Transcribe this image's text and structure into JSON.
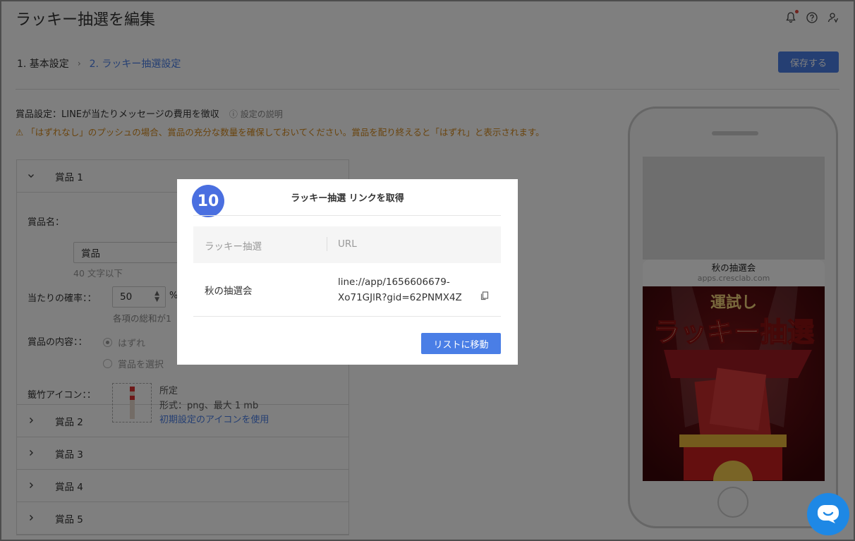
{
  "header": {
    "title": "ラッキー抽選を編集",
    "icons": [
      "bell-icon",
      "help-circle-icon",
      "user-switch-icon"
    ]
  },
  "steps": {
    "step1": "1. 基本設定",
    "separator": "›",
    "step2": "2. ラッキー抽選設定",
    "save_label": "保存する"
  },
  "prize_setting": {
    "label": "賞品設定：LINEが当たりメッセージの費用を徴収",
    "help": "設定の説明",
    "warning": "「はずれなし」のプッシュの場合、賞品の充分な数量を確保しておいてください。賞品を配り終えると「はずれ」と表示されます。"
  },
  "prizes": [
    {
      "label": "賞品 1",
      "expanded": true
    },
    {
      "label": "賞品 2"
    },
    {
      "label": "賞品 3"
    },
    {
      "label": "賞品 4"
    },
    {
      "label": "賞品 5"
    }
  ],
  "prize1_form": {
    "name_label": "賞品名：",
    "name_value": "賞品",
    "name_hint": "40 文字以下",
    "rate_label": "当たりの確率：：",
    "rate_value": "50",
    "rate_unit": "%",
    "rate_hint": "各項の総和が1",
    "content_label": "賞品の内容：：",
    "opt_miss": "はずれ",
    "opt_select": "賞品を選択",
    "icon_label": "籤竹アイコン：：",
    "icon_hint1": "所定",
    "icon_hint2": "形式：png、最大 1 mb",
    "icon_default_link": "初期設定のアイコンを使用"
  },
  "phone_preview": {
    "title": "秋の抽選会",
    "url": "apps.cresclab.com",
    "art_top": "運試し",
    "art_main": "ラッキー抽選"
  },
  "modal": {
    "step_number": "10",
    "title": "ラッキー抽選 リンクを取得",
    "col_name": "ラッキー抽選",
    "col_url": "URL",
    "row_name": "秋の抽選会",
    "row_url": "line://app/1656606679-Xo71GJlR?gid=62PNMX4Z",
    "button": "リストに移動"
  },
  "colors": {
    "accent": "#4a7ee6",
    "badge": "#4a6fe0",
    "warning": "#d4881a",
    "chat": "#1e88e5"
  }
}
